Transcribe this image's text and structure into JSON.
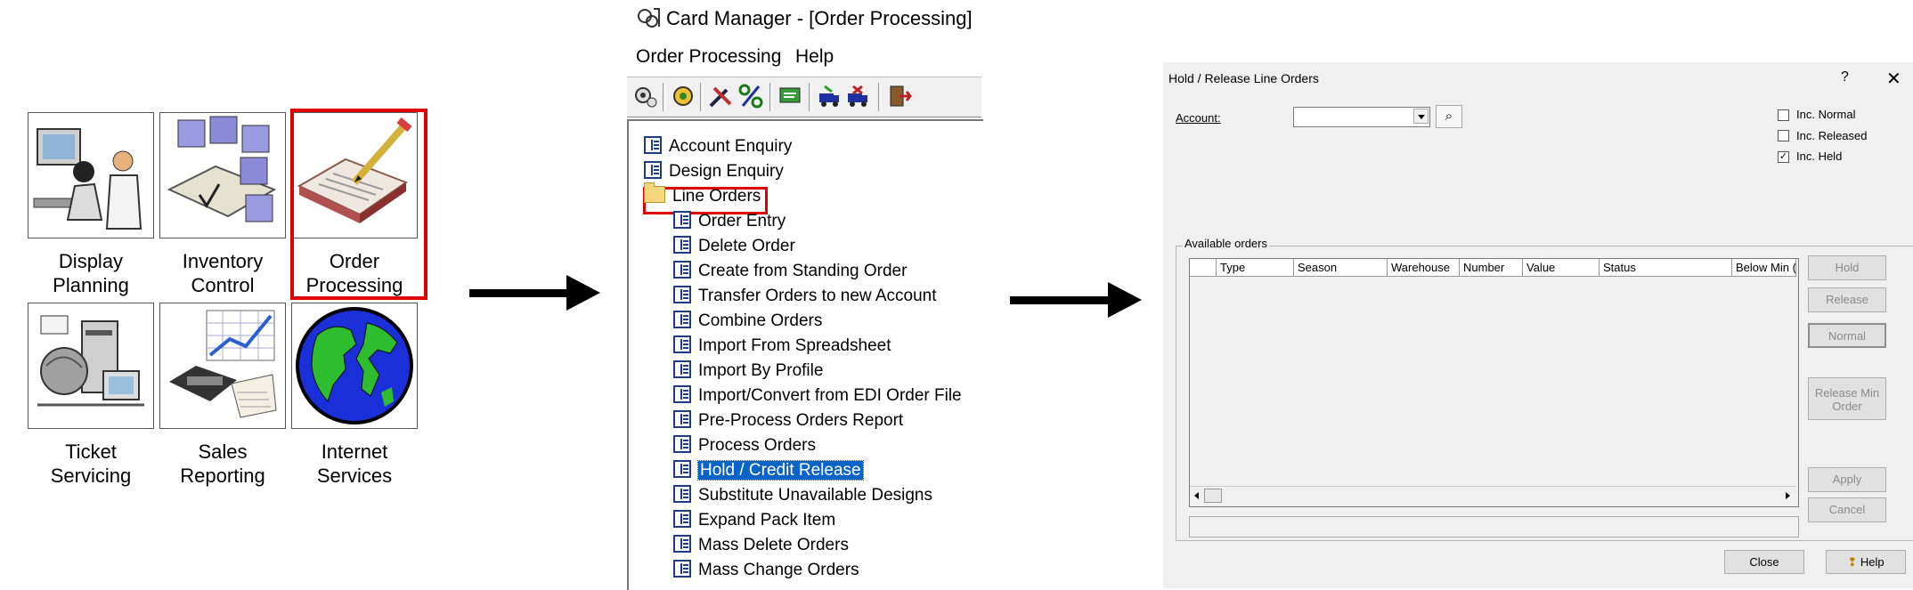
{
  "launcher": {
    "tiles": [
      {
        "line1": "Display",
        "line2": "Planning"
      },
      {
        "line1": "Inventory",
        "line2": "Control"
      },
      {
        "line1": "Order",
        "line2": "Processing"
      },
      {
        "line1": "Ticket",
        "line2": "Servicing"
      },
      {
        "line1": "Sales",
        "line2": "Reporting"
      },
      {
        "line1": "Internet",
        "line2": "Services"
      }
    ],
    "selected_tile": "Order Processing"
  },
  "card_manager": {
    "title": "Card Manager - [Order Processing]",
    "menu": [
      "Order Processing",
      "Help"
    ],
    "tree": [
      {
        "label": "Account Enquiry",
        "level": 0,
        "icon": "doc-icon"
      },
      {
        "label": "Design Enquiry",
        "level": 0,
        "icon": "doc-icon"
      },
      {
        "label": "Line Orders",
        "level": 0,
        "icon": "folder-icon"
      },
      {
        "label": "Order Entry",
        "level": 1,
        "icon": "doc-icon"
      },
      {
        "label": "Delete Order",
        "level": 1,
        "icon": "doc-icon"
      },
      {
        "label": "Create from Standing Order",
        "level": 1,
        "icon": "doc-icon"
      },
      {
        "label": "Transfer Orders to new Account",
        "level": 1,
        "icon": "doc-icon"
      },
      {
        "label": "Combine Orders",
        "level": 1,
        "icon": "doc-icon"
      },
      {
        "label": "Import From Spreadsheet",
        "level": 1,
        "icon": "doc-icon"
      },
      {
        "label": "Import By Profile",
        "level": 1,
        "icon": "doc-icon"
      },
      {
        "label": "Import/Convert from EDI Order File",
        "level": 1,
        "icon": "doc-icon"
      },
      {
        "label": "Pre-Process Orders Report",
        "level": 1,
        "icon": "doc-icon"
      },
      {
        "label": "Process Orders",
        "level": 1,
        "icon": "doc-icon"
      },
      {
        "label": "Hold / Credit Release",
        "level": 1,
        "icon": "doc-icon"
      },
      {
        "label": "Substitute Unavailable Designs",
        "level": 1,
        "icon": "doc-icon"
      },
      {
        "label": "Expand Pack Item",
        "level": 1,
        "icon": "doc-icon"
      },
      {
        "label": "Mass Delete Orders",
        "level": 1,
        "icon": "doc-icon"
      },
      {
        "label": "Mass Change Orders",
        "level": 1,
        "icon": "doc-icon"
      }
    ],
    "highlighted": "Hold / Credit Release",
    "boxed": "Line Orders"
  },
  "dialog": {
    "title": "Hold / Release Line Orders",
    "help_glyph": "?",
    "close_glyph": "✕",
    "account_label": "Account:",
    "account_value": "",
    "checkboxes": [
      {
        "label": "Inc. Normal",
        "checked": false
      },
      {
        "label": "Inc. Released",
        "checked": false
      },
      {
        "label": "Inc. Held",
        "checked": true
      }
    ],
    "group_label": "Available orders",
    "columns": [
      "Type",
      "Season",
      "Warehouse",
      "Number",
      "Value",
      "Status",
      "Below Min ("
    ],
    "side_buttons": [
      "Hold",
      "Release",
      "Normal",
      "Release Min Order",
      "Apply",
      "Cancel"
    ],
    "bottom_buttons": [
      "Close",
      "Help"
    ],
    "check_mark": "✓",
    "binoculars_glyph": "⌕"
  }
}
